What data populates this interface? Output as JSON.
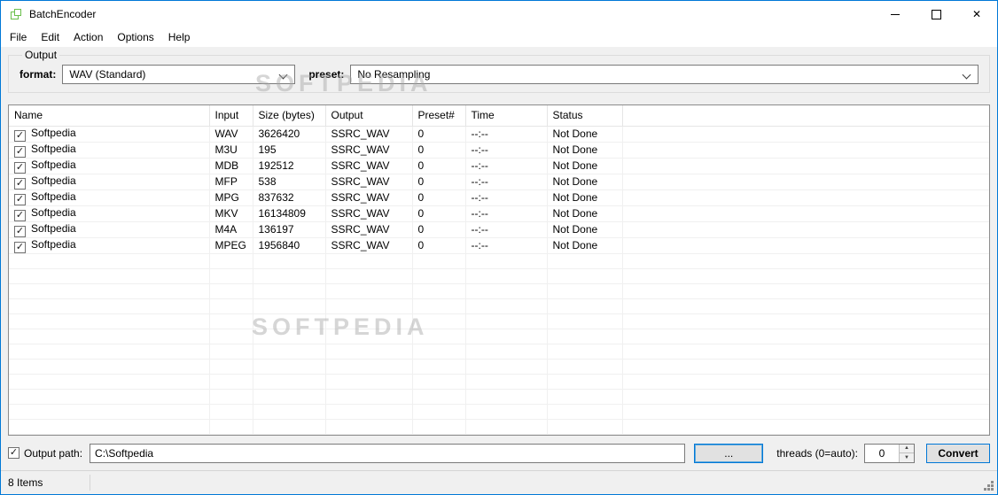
{
  "colors": {
    "accent": "#0078d7",
    "app_icon_green": "#6abf4b"
  },
  "icons": {
    "check": "✓",
    "close": "✕",
    "spin_up": "▲",
    "spin_down": "▼"
  },
  "titlebar": {
    "title": "BatchEncoder"
  },
  "menu": {
    "items": [
      "File",
      "Edit",
      "Action",
      "Options",
      "Help"
    ]
  },
  "output_group": {
    "title": "Output",
    "format_label": "format:",
    "format_value": "WAV (Standard)",
    "preset_label": "preset:",
    "preset_value": "No Resampling"
  },
  "watermark": "SOFTPEDIA",
  "table": {
    "columns": [
      "Name",
      "Input",
      "Size (bytes)",
      "Output",
      "Preset#",
      "Time",
      "Status"
    ],
    "rows": [
      {
        "checked": true,
        "name": "Softpedia",
        "input": "WAV",
        "size_bytes": "3626420",
        "output": "SSRC_WAV",
        "preset_num": "0",
        "time": "--:--",
        "status": "Not Done"
      },
      {
        "checked": true,
        "name": "Softpedia",
        "input": "M3U",
        "size_bytes": "195",
        "output": "SSRC_WAV",
        "preset_num": "0",
        "time": "--:--",
        "status": "Not Done"
      },
      {
        "checked": true,
        "name": "Softpedia",
        "input": "MDB",
        "size_bytes": "192512",
        "output": "SSRC_WAV",
        "preset_num": "0",
        "time": "--:--",
        "status": "Not Done"
      },
      {
        "checked": true,
        "name": "Softpedia",
        "input": "MFP",
        "size_bytes": "538",
        "output": "SSRC_WAV",
        "preset_num": "0",
        "time": "--:--",
        "status": "Not Done"
      },
      {
        "checked": true,
        "name": "Softpedia",
        "input": "MPG",
        "size_bytes": "837632",
        "output": "SSRC_WAV",
        "preset_num": "0",
        "time": "--:--",
        "status": "Not Done"
      },
      {
        "checked": true,
        "name": "Softpedia",
        "input": "MKV",
        "size_bytes": "16134809",
        "output": "SSRC_WAV",
        "preset_num": "0",
        "time": "--:--",
        "status": "Not Done"
      },
      {
        "checked": true,
        "name": "Softpedia",
        "input": "M4A",
        "size_bytes": "136197",
        "output": "SSRC_WAV",
        "preset_num": "0",
        "time": "--:--",
        "status": "Not Done"
      },
      {
        "checked": true,
        "name": "Softpedia",
        "input": "MPEG",
        "size_bytes": "1956840",
        "output": "SSRC_WAV",
        "preset_num": "0",
        "time": "--:--",
        "status": "Not Done"
      }
    ]
  },
  "bottom_bar": {
    "output_path_checked": true,
    "output_path_label": "Output path:",
    "output_path_value": "C:\\Softpedia",
    "browse_button": "...",
    "threads_label": "threads (0=auto):",
    "threads_value": "0",
    "convert_button": "Convert"
  },
  "statusbar": {
    "text": "8 Items"
  }
}
